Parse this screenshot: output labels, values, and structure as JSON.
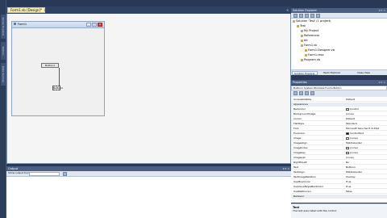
{
  "designer": {
    "tab_label": "Form1.vb [Design]*",
    "close_glyph": "×"
  },
  "form": {
    "title": "Form1",
    "min_glyph": "_",
    "max_glyph": "□",
    "close_glyph": "×",
    "button1_label": "Button1",
    "button2_label": "Button2"
  },
  "left_strip": {
    "tabs": [
      "Server Explorer",
      "Toolbox",
      "Data Sources"
    ]
  },
  "solution_explorer": {
    "title": "Solution Explorer",
    "controls": "▾ ⊓ ×",
    "tree": [
      {
        "label": "Solution 'Test' (1 project)",
        "indent": 0
      },
      {
        "label": "Test",
        "indent": 1
      },
      {
        "label": "My Project",
        "indent": 2
      },
      {
        "label": "References",
        "indent": 2
      },
      {
        "label": "bin",
        "indent": 2
      },
      {
        "label": "Form1.vb",
        "indent": 2
      },
      {
        "label": "Form1.Designer.vb",
        "indent": 3
      },
      {
        "label": "Form1.resx",
        "indent": 3
      },
      {
        "label": "Program.vb",
        "indent": 2
      }
    ],
    "tabs": [
      "Solution Explorer",
      "Team Explorer",
      "Class View"
    ]
  },
  "properties": {
    "title": "Properties",
    "controls": "▾ ⊓ ×",
    "object": "Button1 System.Windows.Forms.Button",
    "rows": [
      {
        "name": "AccessibleRole",
        "value": "Default",
        "cat": false
      },
      {
        "name": "Appearance",
        "value": "",
        "cat": true
      },
      {
        "name": "BackColor",
        "value": "Control",
        "cat": false,
        "swatch": "#ececec"
      },
      {
        "name": "BackgroundImage",
        "value": "(none)",
        "cat": false
      },
      {
        "name": "Cursor",
        "value": "Default",
        "cat": false
      },
      {
        "name": "FlatStyle",
        "value": "Standard",
        "cat": false
      },
      {
        "name": "Font",
        "value": "Microsoft Sans Serif, 8.25pt",
        "cat": false
      },
      {
        "name": "ForeColor",
        "value": "ControlText",
        "cat": false,
        "swatch": "#000000"
      },
      {
        "name": "Image",
        "value": "(none)",
        "cat": false,
        "swatch": "#ffffff"
      },
      {
        "name": "ImageAlign",
        "value": "MiddleCenter",
        "cat": false
      },
      {
        "name": "ImageIndex",
        "value": "(none)",
        "cat": false,
        "swatch": "#ffffff"
      },
      {
        "name": "ImageKey",
        "value": "(none)",
        "cat": false,
        "swatch": "#ffffff"
      },
      {
        "name": "ImageList",
        "value": "(none)",
        "cat": false
      },
      {
        "name": "RightToLeft",
        "value": "No",
        "cat": false
      },
      {
        "name": "Text",
        "value": "Button1",
        "cat": false
      },
      {
        "name": "TextAlign",
        "value": "MiddleCenter",
        "cat": false
      },
      {
        "name": "TextImageRelation",
        "value": "Overlay",
        "cat": false
      },
      {
        "name": "UseMnemonic",
        "value": "True",
        "cat": false
      },
      {
        "name": "UseVisualStyleBackColor",
        "value": "True",
        "cat": false
      },
      {
        "name": "UseWaitCursor",
        "value": "False",
        "cat": false
      },
      {
        "name": "Behavior",
        "value": "",
        "cat": true
      }
    ],
    "desc_title": "Text",
    "desc_text": "The text associated with the control."
  },
  "output": {
    "title": "Output",
    "controls": "▾ ⊓ ×",
    "show_label": "Show output from:"
  }
}
